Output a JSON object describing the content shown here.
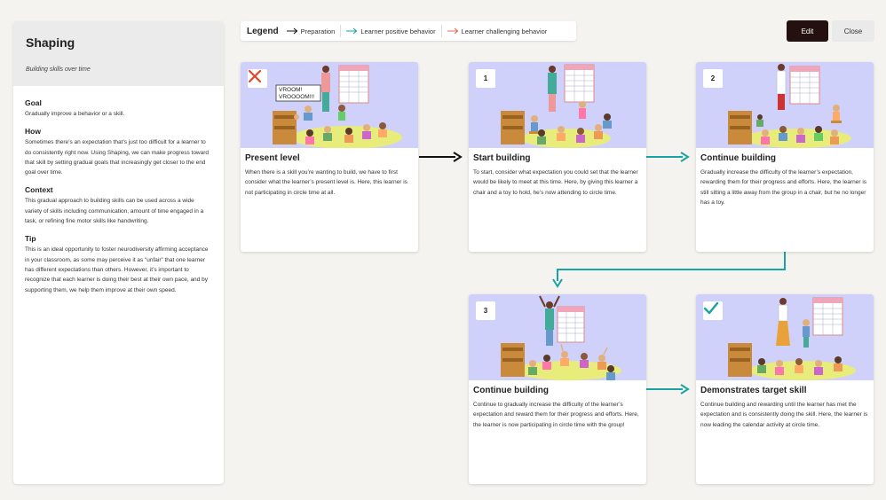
{
  "sidebar": {
    "title": "Shaping",
    "subtitle": "Building skills over time",
    "sections": [
      {
        "heading": "Goal",
        "text": "Gradually improve a behavior or a skill."
      },
      {
        "heading": "How",
        "text": "Sometimes there’s an expectation that’s just too difficult for a learner to do consistently right now. Using Shaping, we can make progress toward that skill by setting gradual goals that increasingly get closer to the end goal over time."
      },
      {
        "heading": "Context",
        "text": "This gradual approach to building skills can be used across a wide variety of skills including communication, amount of time engaged in a task, or refining fine motor skills like handwriting."
      },
      {
        "heading": "Tip",
        "text": "This is an ideal opportunity to foster neurodiversity affirming acceptance in your classroom, as some may perceive it as “unfair” that one learner has different expectations than others. However, it’s important to recognize that each learner is doing their best at their own pace, and by supporting them, we help them improve at their own speed."
      }
    ]
  },
  "legend": {
    "title": "Legend",
    "items": [
      {
        "label": "Preparation",
        "color": "#111111"
      },
      {
        "label": "Learner positive behavior",
        "color": "#1aa3a3"
      },
      {
        "label": "Learner challenging behavior",
        "color": "#e8684e"
      }
    ]
  },
  "buttons": {
    "edit": "Edit",
    "close": "Close"
  },
  "colors": {
    "positive": "#1aa3a3",
    "preparation": "#111111",
    "challenging": "#e8684e",
    "not_met": "#e0462a",
    "met": "#1aa3a3",
    "illustration_bg": "#cfd1fb"
  },
  "cards": [
    {
      "badge": "",
      "badge_icon": "x-icon",
      "title": "Present level",
      "speech": "VROOM! VROOOOM!!!",
      "desc": "When there is a skill you’re wanting to build, we have to first consider what the learner’s present level is. Here, this learner is not participating in circle time at all."
    },
    {
      "badge": "1",
      "title": "Start building",
      "desc": "To start, consider what expectation you could set that the learner would be likely to meet at this time. Here, by giving this learner a chair and a toy to hold, he’s now attending to circle time."
    },
    {
      "badge": "2",
      "title": "Continue building",
      "desc": "Gradually increase the difficulty of the learner’s expectation, rewarding them for their progress and efforts. Here, the learner is still sitting a little away from the group in a chair, but he no longer has a toy."
    },
    {
      "badge": "3",
      "title": "Continue building",
      "desc": "Continue to gradually increase the difficulty of the learner’s expectation and reward them for their progress and efforts. Here, the learner is now participating in circle time with the group!"
    },
    {
      "badge": "",
      "badge_icon": "check-icon",
      "title": "Demonstrates target skill",
      "desc": "Continue building and rewarding until the learner has met the expectation and is consistently doing the skill. Here, the learner is now leading the calendar activity at circle time."
    }
  ],
  "connections": [
    {
      "from": 0,
      "to": 1,
      "kind": "Preparation"
    },
    {
      "from": 1,
      "to": 2,
      "kind": "Learner positive behavior"
    },
    {
      "from": 2,
      "to": 3,
      "kind": "Learner positive behavior"
    },
    {
      "from": 3,
      "to": 4,
      "kind": "Learner positive behavior"
    }
  ]
}
